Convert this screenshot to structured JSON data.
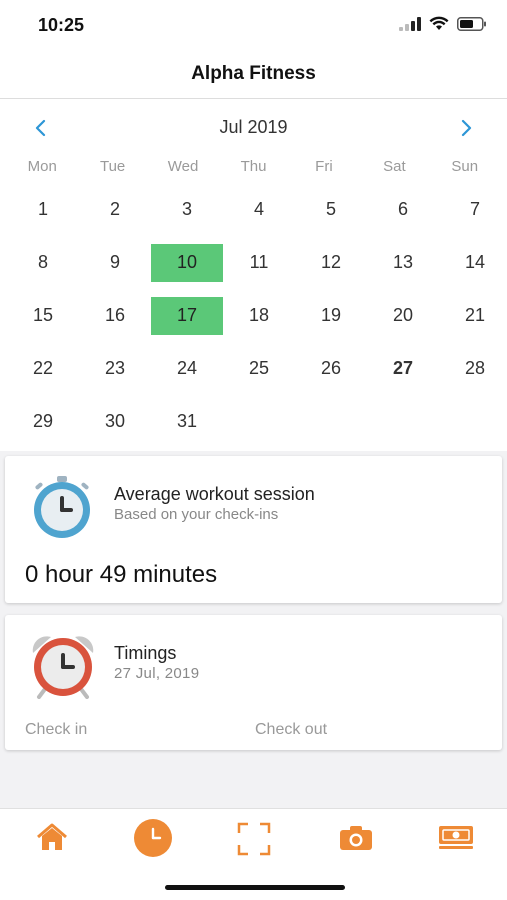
{
  "status_bar": {
    "time": "10:25"
  },
  "header": {
    "title": "Alpha Fitness"
  },
  "calendar": {
    "month_label": "Jul 2019",
    "weekdays": [
      "Mon",
      "Tue",
      "Wed",
      "Thu",
      "Fri",
      "Sat",
      "Sun"
    ],
    "days": [
      "1",
      "2",
      "3",
      "4",
      "5",
      "6",
      "7",
      "8",
      "9",
      "10",
      "11",
      "12",
      "13",
      "14",
      "15",
      "16",
      "17",
      "18",
      "19",
      "20",
      "21",
      "22",
      "23",
      "24",
      "25",
      "26",
      "27",
      "28",
      "29",
      "30",
      "31"
    ],
    "highlighted_days": [
      "10",
      "17"
    ],
    "bold_day": "27",
    "highlight_color": "#5bc878"
  },
  "workout_card": {
    "title": "Average workout session",
    "subtitle": "Based on your check-ins",
    "duration": "0 hour 49 minutes"
  },
  "timings_card": {
    "title": "Timings",
    "date": "27 Jul, 2019",
    "check_in_label": "Check in",
    "check_out_label": "Check out"
  },
  "tab_bar": {
    "accent_color": "#ee8a35",
    "tabs": [
      "home-icon",
      "clock-icon",
      "scan-icon",
      "camera-icon",
      "money-icon"
    ]
  }
}
